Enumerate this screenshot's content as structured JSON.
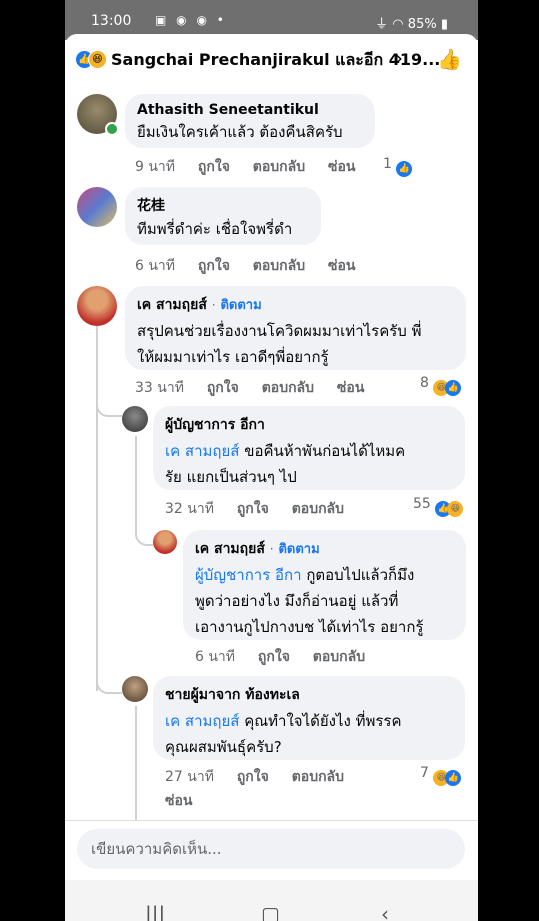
{
  "status": {
    "time": "13:00",
    "battery": "85%"
  },
  "header": {
    "title": "Sangchai Prechanjirakul และอีก 419..."
  },
  "comments": [
    {
      "name": "Athasith Seneetantikul",
      "text": "ยืมเงินใครเค้าแล้ว ต้องคืนสิครับ",
      "time": "9 นาที",
      "like": "ถูกใจ",
      "reply": "ตอบกลับ",
      "hide": "ซ่อน",
      "count": "1"
    },
    {
      "name": "花桂",
      "text": "ทีมพรี่ดำค่ะ เชื่อใจพรี่ดำ",
      "time": "6 นาที",
      "like": "ถูกใจ",
      "reply": "ตอบกลับ",
      "hide": "ซ่อน"
    },
    {
      "name": "เค สามฤยส์",
      "follow": "ติดตาม",
      "text1": "สรุปคนช่วยเรื่องงานโควิดผมมาเท่าไรครับ พี่",
      "text2": "ให้ผมมาเท่าไร เอาดีๆพี่อยากรู้",
      "time": "33 นาที",
      "like": "ถูกใจ",
      "reply": "ตอบกลับ",
      "hide": "ซ่อน",
      "count": "8"
    },
    {
      "name": "ผู้บัญชาการ อีกา",
      "mention": "เค สามฤยส์",
      "text1": " ขอคืนห้าพันก่อนได้ไหมค",
      "text2": "รัย แยกเป็นส่วนๆ ไป",
      "time": "32 นาที",
      "like": "ถูกใจ",
      "reply": "ตอบกลับ",
      "count": "55"
    },
    {
      "name": "เค สามฤยส์",
      "follow": "ติดตาม",
      "mention": "ผู้บัญชาการ อีกา",
      "text1": " กูตอบไปแล้วก็มึง",
      "text2": "พูดว่าอย่างไง มึงก็อ่านอยู่ แล้วที่",
      "text3": "เอางานกูไปกางบช ได้เท่าไร อยากรู้",
      "time": "6 นาที",
      "like": "ถูกใจ",
      "reply": "ตอบกลับ"
    },
    {
      "name": "ชายผู้มาจาก ท้องทะเล",
      "mention": "เค สามฤยส์",
      "text1": " คุณทำใจได้ยังไง ที่พรรค",
      "text2": "คุณผสมพันธุ์ครับ?",
      "time": "27 นาที",
      "like": "ถูกใจ",
      "reply": "ตอบกลับ",
      "hide": "ซ่อน",
      "count": "7"
    }
  ],
  "composer": {
    "placeholder": "เขียนความคิดเห็น..."
  },
  "colors": {
    "accent": "#1877f2",
    "bubble": "#f0f2f5",
    "online": "#31a24c"
  }
}
